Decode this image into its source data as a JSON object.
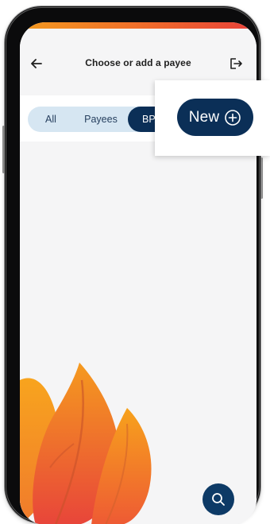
{
  "header": {
    "title": "Choose or add a payee",
    "back_icon": "arrow-left-icon",
    "logout_icon": "logout-icon"
  },
  "filter": {
    "tabs": [
      {
        "label": "All",
        "selected": false
      },
      {
        "label": "Payees",
        "selected": false
      },
      {
        "label": "BPA",
        "selected": true
      }
    ]
  },
  "popup": {
    "new_label": "New",
    "new_icon": "plus-circle-icon"
  },
  "fab": {
    "icon": "search-icon"
  },
  "colors": {
    "navy": "#0b2f57",
    "segment_bg": "#d6e6f2",
    "accent_orange": "#f39a1f",
    "accent_red": "#e8413a",
    "screen_bg": "#f5f5f6"
  }
}
